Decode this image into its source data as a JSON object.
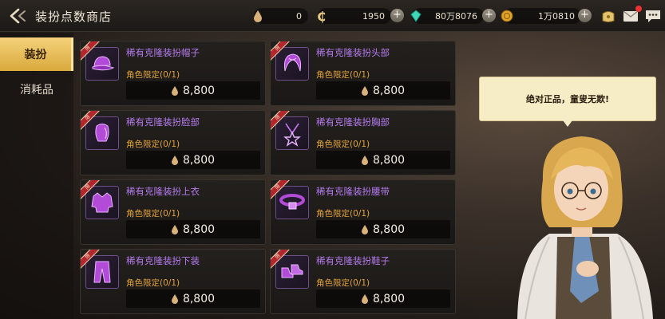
{
  "header": {
    "title": "装扮点数商店"
  },
  "currencies": [
    {
      "name": "costume-points",
      "value": "0",
      "icon": "drop-icon"
    },
    {
      "name": "gold-coin",
      "value": "1950",
      "icon": "c-coin-icon"
    },
    {
      "name": "gem",
      "value": "80万8076",
      "icon": "gem-icon"
    },
    {
      "name": "medal",
      "value": "1万0810",
      "icon": "medal-icon"
    }
  ],
  "sidebar": {
    "tabs": [
      {
        "label": "装扮",
        "active": true
      },
      {
        "label": "消耗品",
        "active": false
      }
    ]
  },
  "items": [
    {
      "name": "稀有克隆装扮帽子",
      "limit": "角色限定(0/1)",
      "price": "8,800",
      "ribbon": "限",
      "icon": "hat-icon"
    },
    {
      "name": "稀有克隆装扮头部",
      "limit": "角色限定(0/1)",
      "price": "8,800",
      "ribbon": "限",
      "icon": "hair-icon"
    },
    {
      "name": "稀有克隆装扮脸部",
      "limit": "角色限定(0/1)",
      "price": "8,800",
      "ribbon": "限",
      "icon": "face-icon"
    },
    {
      "name": "稀有克隆装扮胸部",
      "limit": "角色限定(0/1)",
      "price": "8,800",
      "ribbon": "限",
      "icon": "necklace-icon"
    },
    {
      "name": "稀有克隆装扮上衣",
      "limit": "角色限定(0/1)",
      "price": "8,800",
      "ribbon": "限",
      "icon": "coat-icon"
    },
    {
      "name": "稀有克隆装扮腰带",
      "limit": "角色限定(0/1)",
      "price": "8,800",
      "ribbon": "限",
      "icon": "belt-icon"
    },
    {
      "name": "稀有克隆装扮下装",
      "limit": "角色限定(0/1)",
      "price": "8,800",
      "ribbon": "限",
      "icon": "pants-icon"
    },
    {
      "name": "稀有克隆装扮鞋子",
      "limit": "角色限定(0/1)",
      "price": "8,800",
      "ribbon": "限",
      "icon": "shoes-icon"
    }
  ],
  "npc": {
    "speech": "绝对正品，童叟无欺!"
  },
  "colors": {
    "accent_gold": "#d9a93c",
    "item_name_purple": "#b67cf0",
    "limit_orange": "#e2a23b",
    "ribbon_red": "#b3262d"
  }
}
